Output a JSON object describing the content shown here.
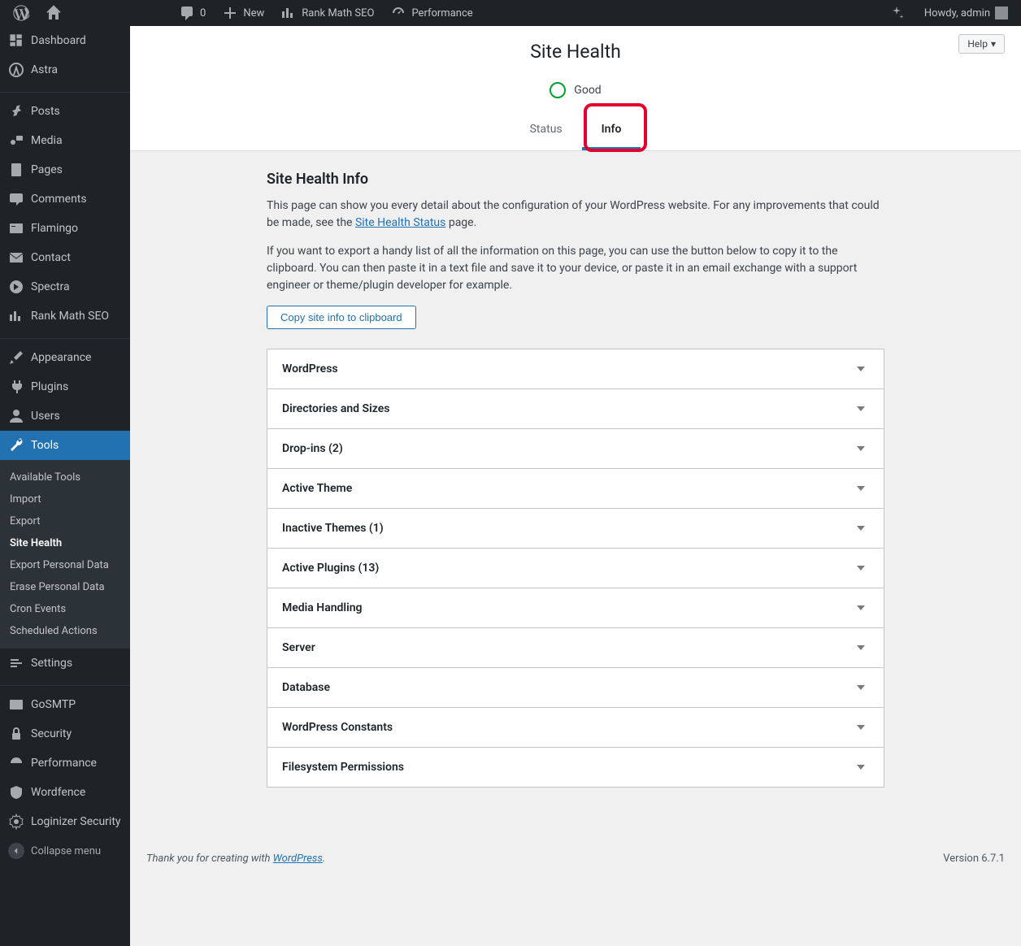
{
  "adminbar": {
    "comments_count": "0",
    "new_label": "New",
    "rankmath_label": "Rank Math SEO",
    "performance_label": "Performance",
    "howdy": "Howdy, admin"
  },
  "sidebar": {
    "items": [
      {
        "label": "Dashboard"
      },
      {
        "label": "Astra"
      },
      {
        "label": "Posts"
      },
      {
        "label": "Media"
      },
      {
        "label": "Pages"
      },
      {
        "label": "Comments"
      },
      {
        "label": "Flamingo"
      },
      {
        "label": "Contact"
      },
      {
        "label": "Spectra"
      },
      {
        "label": "Rank Math SEO"
      },
      {
        "label": "Appearance"
      },
      {
        "label": "Plugins"
      },
      {
        "label": "Users"
      },
      {
        "label": "Tools"
      },
      {
        "label": "Settings"
      },
      {
        "label": "GoSMTP"
      },
      {
        "label": "Security"
      },
      {
        "label": "Performance"
      },
      {
        "label": "Wordfence"
      },
      {
        "label": "Loginizer Security"
      }
    ],
    "tools_submenu": [
      "Available Tools",
      "Import",
      "Export",
      "Site Health",
      "Export Personal Data",
      "Erase Personal Data",
      "Cron Events",
      "Scheduled Actions"
    ],
    "collapse": "Collapse menu"
  },
  "help_label": "Help",
  "header": {
    "title": "Site Health",
    "status_label": "Good",
    "tab_status": "Status",
    "tab_info": "Info"
  },
  "info": {
    "heading": "Site Health Info",
    "p1a": "This page can show you every detail about the configuration of your WordPress website. For any improvements that could be made, see the ",
    "p1_link": "Site Health Status",
    "p1b": " page.",
    "p2": "If you want to export a handy list of all the information on this page, you can use the button below to copy it to the clipboard. You can then paste it in a text file and save it to your device, or paste it in an email exchange with a support engineer or theme/plugin developer for example.",
    "copy_btn": "Copy site info to clipboard",
    "sections": [
      "WordPress",
      "Directories and Sizes",
      "Drop-ins (2)",
      "Active Theme",
      "Inactive Themes (1)",
      "Active Plugins (13)",
      "Media Handling",
      "Server",
      "Database",
      "WordPress Constants",
      "Filesystem Permissions"
    ]
  },
  "footer": {
    "thanks_a": "Thank you for creating with ",
    "thanks_link": "WordPress",
    "thanks_b": ".",
    "version": "Version 6.7.1"
  }
}
